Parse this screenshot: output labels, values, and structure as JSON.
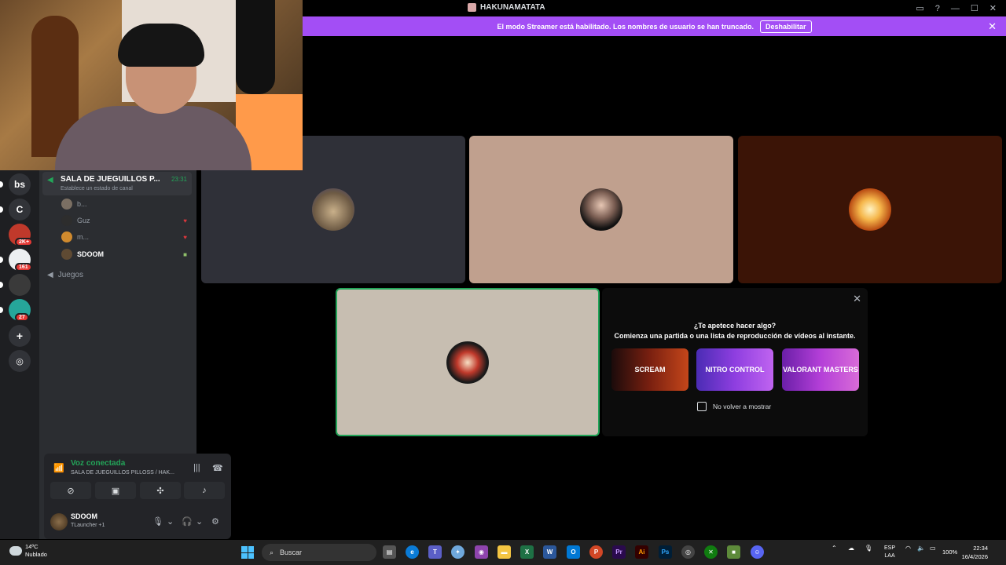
{
  "window": {
    "title": "HAKUNAMATATA"
  },
  "banner": {
    "text": "El modo Streamer está habilitado. Los nombres de usuario se han truncado.",
    "button": "Deshabilitar",
    "close": "✕"
  },
  "rail": {
    "servers": [
      {
        "label": "bs"
      },
      {
        "label": "C"
      }
    ],
    "badges": [
      "2K+",
      "161",
      "27"
    ]
  },
  "voice_channel": {
    "name": "SALA DE JUEGUILLOS P...",
    "elapsed": "23:31",
    "status_prompt": "Establece un estado de canal",
    "users": [
      {
        "name": "b..."
      },
      {
        "name": "Guz"
      },
      {
        "name": "m..."
      },
      {
        "name": "SDOOM"
      }
    ],
    "other_channel": "Juegos"
  },
  "voice_panel": {
    "label": "Voz conectada",
    "channel": "SALA DE JUEGUILLOS PILLOSS / HAK...",
    "username": "SDOOM",
    "user_status": "TLauncher +1"
  },
  "promo": {
    "question": "¿Te apetece hacer algo?",
    "description": "Comienza una partida o una lista de reproducción de vídeos al instante.",
    "cards": [
      "SCREAM",
      "NITRO CONTROL",
      "VALORANT MASTERS"
    ],
    "dont_show": "No volver a mostrar"
  },
  "taskbar": {
    "temperature": "14ºC",
    "weather": "Nublado",
    "search_placeholder": "Buscar",
    "language": "ESP",
    "layout": "LAA",
    "battery": "100%",
    "time": "22:34",
    "date": "16/4/2026"
  },
  "colors": {
    "accent": "#a34ef5",
    "online": "#23a559",
    "danger": "#da373c"
  }
}
